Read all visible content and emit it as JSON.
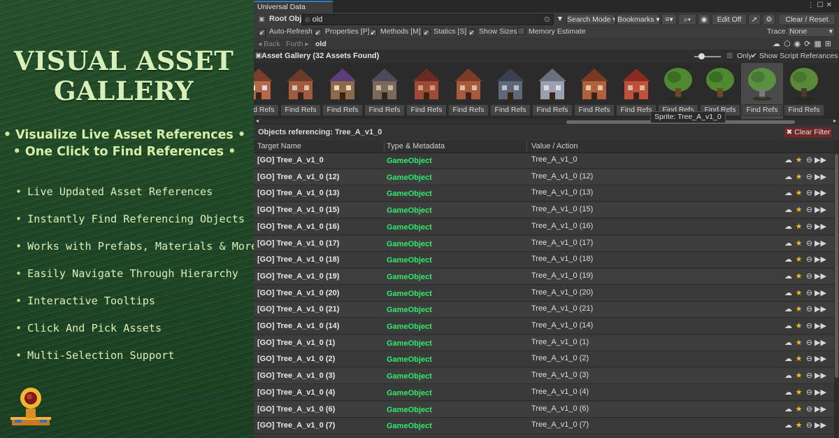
{
  "promo": {
    "title_line1": "VISUAL ASSET",
    "title_line2": "GALLERY",
    "highlights": [
      "Visualize Live Asset References",
      "One Click to Find References"
    ],
    "features": [
      "Live Updated Asset References",
      "Instantly Find Referencing Objects",
      "Works with Prefabs, Materials & More",
      "Easily Navigate Through Hierarchy",
      "Interactive Tooltips",
      "Click And Pick Assets",
      "Multi-Selection Support"
    ],
    "colors": {
      "title": "#d8f0b8",
      "background": "#1f4726"
    }
  },
  "window": {
    "tab_title": "Universal Data Browser",
    "window_icons": [
      "menu-icon",
      "maximize-icon",
      "close-icon"
    ]
  },
  "toolbar": {
    "root_obj_label": "Root Obj:",
    "root_obj_value": "old",
    "search_mode": "Search Mode ▾",
    "bookmarks": "Bookmarks ▾",
    "edit_off": "Edit Off",
    "clear_reset": "Clear / Reset"
  },
  "options": {
    "checks": [
      {
        "label": "Auto-Refresh",
        "checked": true
      },
      {
        "label": "Properties [P]",
        "checked": true
      },
      {
        "label": "Methods [M]",
        "checked": true
      },
      {
        "label": "Statics [S]",
        "checked": true
      },
      {
        "label": "Show Sizes",
        "checked": true
      },
      {
        "label": "Memory Estimate",
        "checked": false
      }
    ],
    "trace_label": "Trace:",
    "trace_value": "None"
  },
  "nav": {
    "back": "◂ Back",
    "forth": "Forth ▸",
    "crumb": "old"
  },
  "gallery": {
    "title": "Asset Gallery (32 Assets Found)",
    "only_label": "Only",
    "show_script_refs": "Show Script Referances",
    "find_refs_label": "Find Refs",
    "tooltip": "Sprite: Tree_A_v1_0",
    "thumb_icons": [
      "house-sprite",
      "house-sprite",
      "house-sprite",
      "house-sprite",
      "cabin-sprite",
      "house-sprite",
      "church-sprite",
      "cathedral-sprite",
      "house-sprite",
      "building-sprite",
      "tree-sprite",
      "tree-sprite",
      "tree-sprite-selected",
      "bush-sprite"
    ]
  },
  "references": {
    "title": "Objects referencing: Tree_A_v1_0",
    "clear_filter": "✖ Clear Filter",
    "columns": [
      "Target Name",
      "Type & Metadata",
      "Value / Action"
    ],
    "rows": [
      {
        "name": "[GO] Tree_A_v1_0",
        "type": "GameObject",
        "value": "Tree_A_v1_0"
      },
      {
        "name": "[GO] Tree_A_v1_0 (12)",
        "type": "GameObject",
        "value": "Tree_A_v1_0 (12)"
      },
      {
        "name": "[GO] Tree_A_v1_0 (13)",
        "type": "GameObject",
        "value": "Tree_A_v1_0 (13)"
      },
      {
        "name": "[GO] Tree_A_v1_0 (15)",
        "type": "GameObject",
        "value": "Tree_A_v1_0 (15)"
      },
      {
        "name": "[GO] Tree_A_v1_0 (16)",
        "type": "GameObject",
        "value": "Tree_A_v1_0 (16)"
      },
      {
        "name": "[GO] Tree_A_v1_0 (17)",
        "type": "GameObject",
        "value": "Tree_A_v1_0 (17)"
      },
      {
        "name": "[GO] Tree_A_v1_0 (18)",
        "type": "GameObject",
        "value": "Tree_A_v1_0 (18)"
      },
      {
        "name": "[GO] Tree_A_v1_0 (19)",
        "type": "GameObject",
        "value": "Tree_A_v1_0 (19)"
      },
      {
        "name": "[GO] Tree_A_v1_0 (20)",
        "type": "GameObject",
        "value": "Tree_A_v1_0 (20)"
      },
      {
        "name": "[GO] Tree_A_v1_0 (21)",
        "type": "GameObject",
        "value": "Tree_A_v1_0 (21)"
      },
      {
        "name": "[GO] Tree_A_v1_0 (14)",
        "type": "GameObject",
        "value": "Tree_A_v1_0 (14)"
      },
      {
        "name": "[GO] Tree_A_v1_0 (1)",
        "type": "GameObject",
        "value": "Tree_A_v1_0 (1)"
      },
      {
        "name": "[GO] Tree_A_v1_0 (2)",
        "type": "GameObject",
        "value": "Tree_A_v1_0 (2)"
      },
      {
        "name": "[GO] Tree_A_v1_0 (3)",
        "type": "GameObject",
        "value": "Tree_A_v1_0 (3)"
      },
      {
        "name": "[GO] Tree_A_v1_0 (4)",
        "type": "GameObject",
        "value": "Tree_A_v1_0 (4)"
      },
      {
        "name": "[GO] Tree_A_v1_0 (6)",
        "type": "GameObject",
        "value": "Tree_A_v1_0 (6)"
      },
      {
        "name": "[GO] Tree_A_v1_0 (7)",
        "type": "GameObject",
        "value": "Tree_A_v1_0 (7)"
      }
    ],
    "type_color": "#2fe96d",
    "row_action_icons": [
      "ping-icon",
      "star-icon",
      "link-icon",
      "expand-icon"
    ]
  }
}
